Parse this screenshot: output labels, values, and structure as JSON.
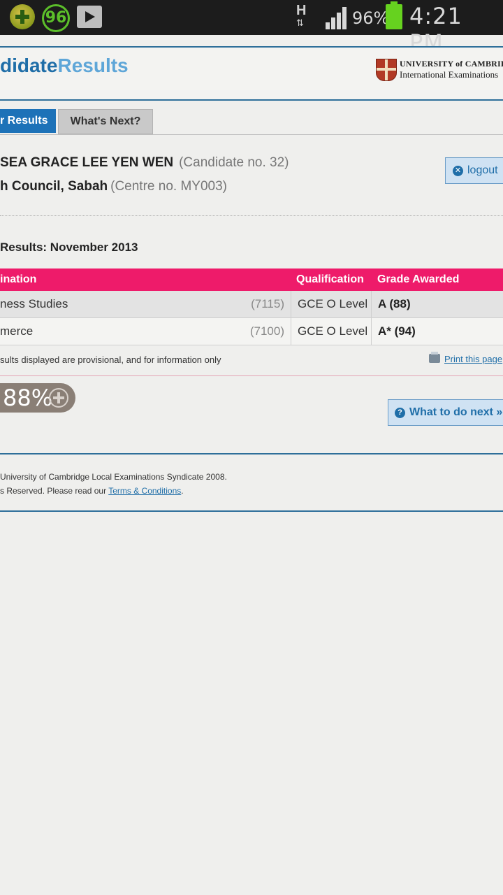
{
  "status_bar": {
    "notification_badge": "96",
    "network": "H",
    "battery": "96%",
    "time": "4:21 PM"
  },
  "header": {
    "logo_dark": "didate",
    "logo_light": "Results",
    "university_line1": "UNIVERSITY of CAMBRIDGE",
    "university_line2": "International Examinations"
  },
  "tabs": [
    {
      "label": "r Results",
      "active": true
    },
    {
      "label": "What's Next?",
      "active": false
    }
  ],
  "candidate": {
    "name": "SEA GRACE LEE YEN WEN",
    "candidate_no": "(Candidate no. 32)",
    "centre": "h Council, Sabah",
    "centre_no": "(Centre no. MY003)"
  },
  "logout_label": "logout",
  "results_title": "Results: November 2013",
  "table": {
    "headers": {
      "subject": "ination",
      "qualification": "Qualification",
      "grade": "Grade Awarded"
    },
    "rows": [
      {
        "subject": "ness Studies",
        "code": "(7115)",
        "qualification": "GCE O Level",
        "grade": "A (88)"
      },
      {
        "subject": "merce",
        "code": "(7100)",
        "qualification": "GCE O Level",
        "grade": "A* (94)"
      }
    ]
  },
  "provisional_note": "sults displayed are provisional, and for information only",
  "print_label": "Print this page",
  "zoom_level": "88%",
  "next_button": "What to do next »",
  "footer": {
    "line1": "University of Cambridge Local Examinations Syndicate 2008.",
    "line2_prefix": "s Reserved. Please read our ",
    "terms_link": "Terms & Conditions",
    "line2_suffix": "."
  }
}
